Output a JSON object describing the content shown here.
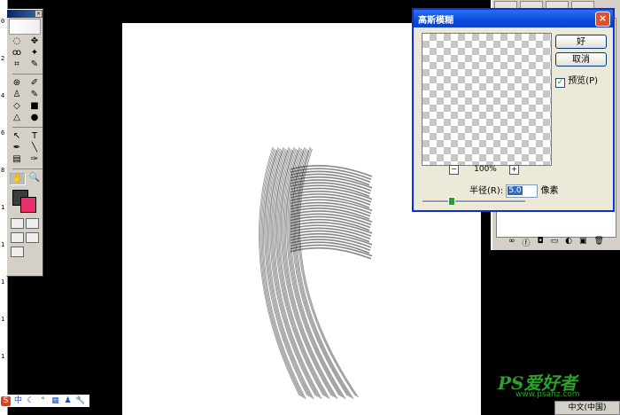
{
  "ruler": {
    "ticks": [
      "0",
      "2",
      "4",
      "6",
      "8",
      "1",
      "1",
      "1",
      "1",
      "1"
    ]
  },
  "toolbox": {
    "tools": [
      "marquee-icon",
      "move-icon",
      "lasso-icon",
      "magic-wand-icon",
      "crop-icon",
      "slice-icon",
      "healing-icon",
      "brush-icon",
      "stamp-icon",
      "history-brush-icon",
      "eraser-icon",
      "gradient-icon",
      "blur-icon",
      "dodge-icon",
      "path-select-icon",
      "type-icon",
      "pen-icon",
      "line-icon",
      "notes-icon",
      "eyedropper-icon",
      "hand-icon",
      "zoom-icon"
    ],
    "glyphs": [
      "◌",
      "✥",
      "ꝏ",
      "✦",
      "⌗",
      "✎",
      "⊛",
      "✐",
      "♙",
      "✎",
      "◇",
      "■",
      "△",
      "●",
      "↖",
      "T",
      "✒",
      "╲",
      "▤",
      "✑",
      "✋",
      "🔍"
    ],
    "fg_color": "#3c3c3c",
    "bg_color": "#e8306a"
  },
  "dialog": {
    "title": "高斯模糊",
    "ok_label": "好",
    "cancel_label": "取消",
    "preview_label": "预览(P)",
    "zoom_minus": "−",
    "zoom_value": "100%",
    "zoom_plus": "+",
    "radius_label": "半径(R):",
    "radius_value": "5.0",
    "radius_unit": "像素",
    "slider_fraction": 0.28
  },
  "watermark": {
    "logo": "PS爱好者",
    "url": "www.psahz.com"
  },
  "language_bar": "中文(中国)",
  "ime": {
    "items": [
      "S",
      "中",
      "☾",
      "°",
      "▦",
      "♟",
      "🔧"
    ]
  }
}
